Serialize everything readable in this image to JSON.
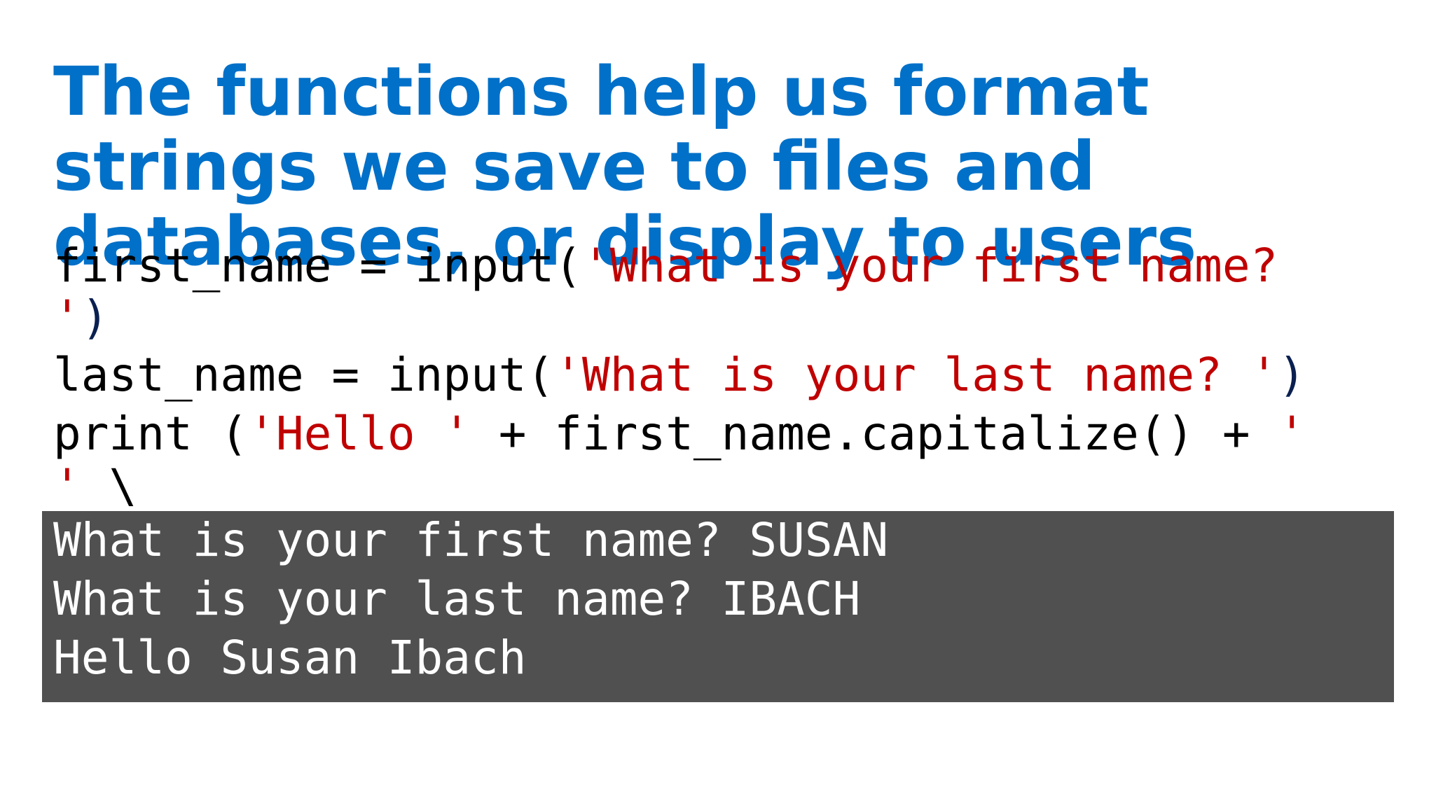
{
  "slide": {
    "title_lines": [
      "The functions help us format",
      "strings we save  to files and",
      "databases, or display to users"
    ],
    "code": {
      "line1": {
        "prefix": "first_name = input(",
        "string": "'What is your first name?",
        "string_cont": "'",
        "close": ")"
      },
      "line2": {
        "prefix": "last_name = input(",
        "string": "'What is your last name? '",
        "close": ")"
      },
      "line3": {
        "prefix": "print (",
        "string1": "'Hello '",
        "middle": " + first_name.capitalize() + ",
        "string2": "'",
        "string2_cont": "'",
        "tail": " \\"
      }
    },
    "output": [
      "What is your first name? SUSAN",
      "What is your last name? IBACH",
      "Hello Susan Ibach"
    ]
  },
  "colors": {
    "title": "#0070C8",
    "string": "#C00000",
    "paren": "#0A2050",
    "output_bg": "#505050",
    "output_text": "#FFFFFF"
  }
}
